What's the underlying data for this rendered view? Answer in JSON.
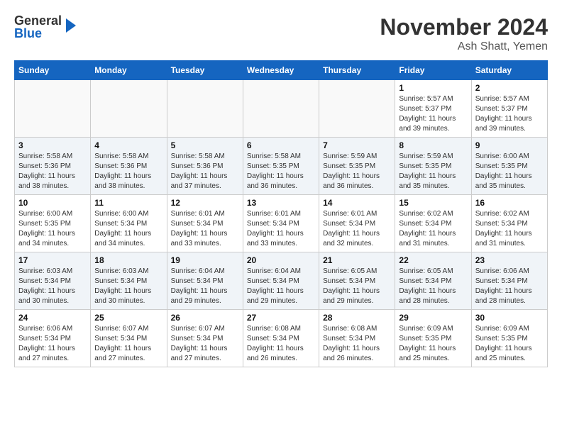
{
  "header": {
    "logo_general": "General",
    "logo_blue": "Blue",
    "month_title": "November 2024",
    "location": "Ash Shatt, Yemen"
  },
  "weekdays": [
    "Sunday",
    "Monday",
    "Tuesday",
    "Wednesday",
    "Thursday",
    "Friday",
    "Saturday"
  ],
  "weeks": [
    [
      {
        "day": "",
        "info": ""
      },
      {
        "day": "",
        "info": ""
      },
      {
        "day": "",
        "info": ""
      },
      {
        "day": "",
        "info": ""
      },
      {
        "day": "",
        "info": ""
      },
      {
        "day": "1",
        "info": "Sunrise: 5:57 AM\nSunset: 5:37 PM\nDaylight: 11 hours and 39 minutes."
      },
      {
        "day": "2",
        "info": "Sunrise: 5:57 AM\nSunset: 5:37 PM\nDaylight: 11 hours and 39 minutes."
      }
    ],
    [
      {
        "day": "3",
        "info": "Sunrise: 5:58 AM\nSunset: 5:36 PM\nDaylight: 11 hours and 38 minutes."
      },
      {
        "day": "4",
        "info": "Sunrise: 5:58 AM\nSunset: 5:36 PM\nDaylight: 11 hours and 38 minutes."
      },
      {
        "day": "5",
        "info": "Sunrise: 5:58 AM\nSunset: 5:36 PM\nDaylight: 11 hours and 37 minutes."
      },
      {
        "day": "6",
        "info": "Sunrise: 5:58 AM\nSunset: 5:35 PM\nDaylight: 11 hours and 36 minutes."
      },
      {
        "day": "7",
        "info": "Sunrise: 5:59 AM\nSunset: 5:35 PM\nDaylight: 11 hours and 36 minutes."
      },
      {
        "day": "8",
        "info": "Sunrise: 5:59 AM\nSunset: 5:35 PM\nDaylight: 11 hours and 35 minutes."
      },
      {
        "day": "9",
        "info": "Sunrise: 6:00 AM\nSunset: 5:35 PM\nDaylight: 11 hours and 35 minutes."
      }
    ],
    [
      {
        "day": "10",
        "info": "Sunrise: 6:00 AM\nSunset: 5:35 PM\nDaylight: 11 hours and 34 minutes."
      },
      {
        "day": "11",
        "info": "Sunrise: 6:00 AM\nSunset: 5:34 PM\nDaylight: 11 hours and 34 minutes."
      },
      {
        "day": "12",
        "info": "Sunrise: 6:01 AM\nSunset: 5:34 PM\nDaylight: 11 hours and 33 minutes."
      },
      {
        "day": "13",
        "info": "Sunrise: 6:01 AM\nSunset: 5:34 PM\nDaylight: 11 hours and 33 minutes."
      },
      {
        "day": "14",
        "info": "Sunrise: 6:01 AM\nSunset: 5:34 PM\nDaylight: 11 hours and 32 minutes."
      },
      {
        "day": "15",
        "info": "Sunrise: 6:02 AM\nSunset: 5:34 PM\nDaylight: 11 hours and 31 minutes."
      },
      {
        "day": "16",
        "info": "Sunrise: 6:02 AM\nSunset: 5:34 PM\nDaylight: 11 hours and 31 minutes."
      }
    ],
    [
      {
        "day": "17",
        "info": "Sunrise: 6:03 AM\nSunset: 5:34 PM\nDaylight: 11 hours and 30 minutes."
      },
      {
        "day": "18",
        "info": "Sunrise: 6:03 AM\nSunset: 5:34 PM\nDaylight: 11 hours and 30 minutes."
      },
      {
        "day": "19",
        "info": "Sunrise: 6:04 AM\nSunset: 5:34 PM\nDaylight: 11 hours and 29 minutes."
      },
      {
        "day": "20",
        "info": "Sunrise: 6:04 AM\nSunset: 5:34 PM\nDaylight: 11 hours and 29 minutes."
      },
      {
        "day": "21",
        "info": "Sunrise: 6:05 AM\nSunset: 5:34 PM\nDaylight: 11 hours and 29 minutes."
      },
      {
        "day": "22",
        "info": "Sunrise: 6:05 AM\nSunset: 5:34 PM\nDaylight: 11 hours and 28 minutes."
      },
      {
        "day": "23",
        "info": "Sunrise: 6:06 AM\nSunset: 5:34 PM\nDaylight: 11 hours and 28 minutes."
      }
    ],
    [
      {
        "day": "24",
        "info": "Sunrise: 6:06 AM\nSunset: 5:34 PM\nDaylight: 11 hours and 27 minutes."
      },
      {
        "day": "25",
        "info": "Sunrise: 6:07 AM\nSunset: 5:34 PM\nDaylight: 11 hours and 27 minutes."
      },
      {
        "day": "26",
        "info": "Sunrise: 6:07 AM\nSunset: 5:34 PM\nDaylight: 11 hours and 27 minutes."
      },
      {
        "day": "27",
        "info": "Sunrise: 6:08 AM\nSunset: 5:34 PM\nDaylight: 11 hours and 26 minutes."
      },
      {
        "day": "28",
        "info": "Sunrise: 6:08 AM\nSunset: 5:34 PM\nDaylight: 11 hours and 26 minutes."
      },
      {
        "day": "29",
        "info": "Sunrise: 6:09 AM\nSunset: 5:35 PM\nDaylight: 11 hours and 25 minutes."
      },
      {
        "day": "30",
        "info": "Sunrise: 6:09 AM\nSunset: 5:35 PM\nDaylight: 11 hours and 25 minutes."
      }
    ]
  ]
}
